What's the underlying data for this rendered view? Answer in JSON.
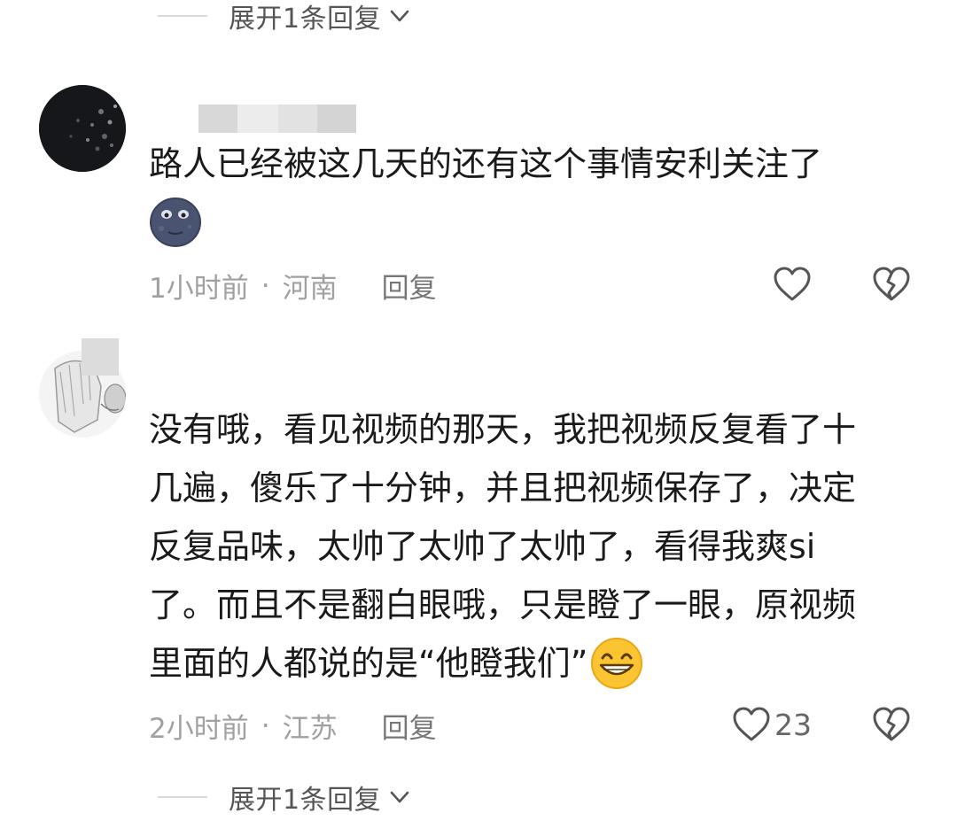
{
  "top_expand": {
    "label": "展开1条回复"
  },
  "comments": [
    {
      "text": "路人已经被这几天的还有这个事情安利关注了",
      "emoji": "moon-face-emoji",
      "time": "1小时前",
      "dot": "·",
      "location": "河南",
      "reply_label": "回复",
      "like_count": ""
    },
    {
      "lines": [
        "没有哦，看见视频的那天，我把视频反复看了十",
        "几遍，傻乐了十分钟，并且把视频保存了，决定",
        "反复品味，太帅了太帅了太帅了，看得我爽si",
        "了。而且不是翻白眼哦，只是瞪了一眼，原视频",
        "里面的人都说的是“他瞪我们”"
      ],
      "emoji": "grinning-emoji",
      "time": "2小时前",
      "dot": "·",
      "location": "江苏",
      "reply_label": "回复",
      "like_count": "23"
    }
  ],
  "bottom_expand": {
    "label": "展开1条回复"
  },
  "colors": {
    "meta": "#a0a0a0",
    "text": "#1a1a1a",
    "icon": "#555555"
  }
}
